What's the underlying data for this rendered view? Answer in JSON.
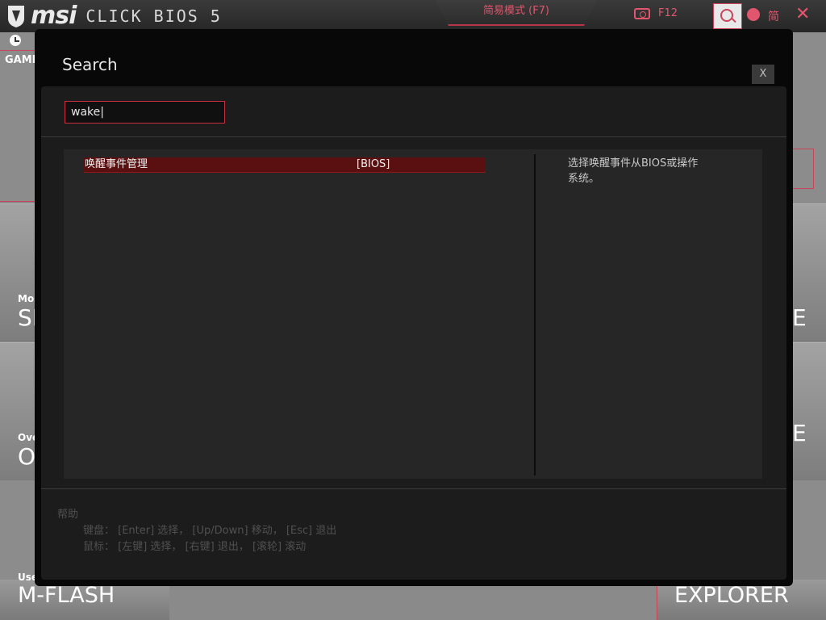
{
  "header": {
    "brand": "msi",
    "product": "CLICK BIOS 5",
    "mode_tab": "简易模式 (F7)",
    "screenshot_key": "F12",
    "language": "简",
    "close_symbol": "✕"
  },
  "background": {
    "game_boost_label": "GAMI",
    "tiles": [
      {
        "sub": "Mo",
        "big": "SI"
      },
      {
        "sub": "Ove",
        "big": "O"
      },
      {
        "sub": "Use",
        "big": "M-FLASH"
      }
    ],
    "right_tiles": [
      {
        "big": "E"
      },
      {
        "big": "E"
      },
      {
        "big": "EXPLORER"
      }
    ]
  },
  "dialog": {
    "title": "Search",
    "close_label": "X",
    "search_value": "wake|",
    "results": [
      {
        "name": "唤醒事件管理",
        "tag": "[BIOS]"
      }
    ],
    "description": "选择唤醒事件从BIOS或操作系统。",
    "help": {
      "title": "帮助",
      "keyboard": "键盘：  [Enter] 选择，  [Up/Down] 移动，  [Esc] 退出",
      "mouse": "鼠标：  [左键] 选择，  [右键] 退出，  [滚轮] 滚动"
    }
  },
  "colors": {
    "accent": "#e2566d",
    "selection": "#5a1010",
    "dialog_bg": "#080808",
    "panel_bg": "#262626"
  }
}
